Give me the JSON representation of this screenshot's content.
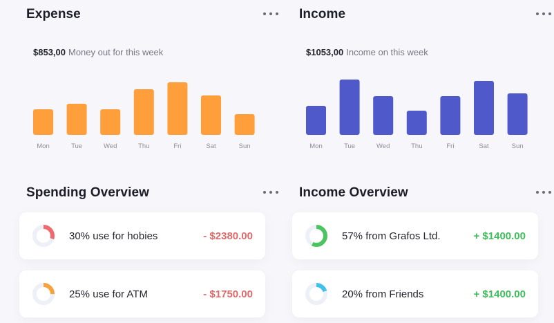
{
  "expense": {
    "title": "Expense",
    "amount": "$853,00",
    "caption": "Money out for this week",
    "color": "#ff9f3b",
    "chart_data": {
      "type": "bar",
      "categories": [
        "Mon",
        "Tue",
        "Wed",
        "Thu",
        "Fri",
        "Sat",
        "Sun"
      ],
      "values": [
        37,
        45,
        37,
        66,
        76,
        57,
        30
      ],
      "ylim": [
        0,
        80
      ]
    }
  },
  "income": {
    "title": "Income",
    "amount": "$1053,00",
    "caption": "Income on this week",
    "color": "#5059c9",
    "chart_data": {
      "type": "bar",
      "categories": [
        "Mon",
        "Tue",
        "Wed",
        "Thu",
        "Fri",
        "Sat",
        "Sun"
      ],
      "values": [
        42,
        80,
        56,
        35,
        56,
        78,
        60
      ],
      "ylim": [
        0,
        80
      ]
    }
  },
  "spending_overview": {
    "title": "Spending Overview",
    "items": [
      {
        "label": "30% use for hobies",
        "value": "- $2380.00",
        "percent": 30,
        "color": "#f0696e"
      },
      {
        "label": "25% use for ATM",
        "value": "- $1750.00",
        "percent": 25,
        "color": "#f7a23c"
      }
    ]
  },
  "income_overview": {
    "title": "Income Overview",
    "items": [
      {
        "label": "57% from Grafos Ltd.",
        "value": "+ $1400.00",
        "percent": 57,
        "color": "#4cc460"
      },
      {
        "label": "20% from Friends",
        "value": "+ $1400.00",
        "percent": 20,
        "color": "#3fc1ea"
      }
    ]
  },
  "icons": {
    "more": "more-horizontal-icon"
  }
}
